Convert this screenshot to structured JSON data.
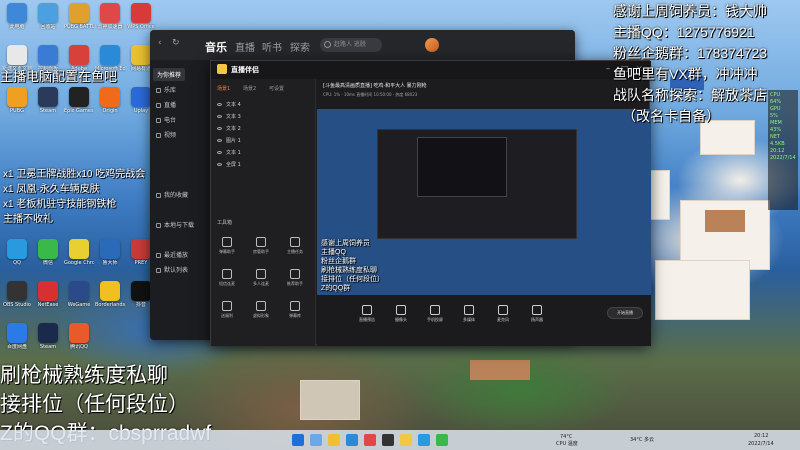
{
  "desktop": {
    "icons": [
      {
        "label": "此电脑",
        "color": "#3d88d8"
      },
      {
        "label": "回收站",
        "color": "#4aa0e0"
      },
      {
        "label": "PUBG BATTLEGR...",
        "color": "#e0a030"
      },
      {
        "label": "雷神加速器",
        "color": "#e04848"
      },
      {
        "label": "WPS Office",
        "color": "#d83a3a"
      },
      {
        "label": "新建文本文档",
        "color": "#e8e8e8"
      },
      {
        "label": "控制面板",
        "color": "#3a7bd5"
      },
      {
        "label": "Adobe",
        "color": "#d8403a"
      },
      {
        "label": "Microsoft Edge",
        "color": "#2a8ad8"
      },
      {
        "label": "网易有道",
        "color": "#e8c030"
      },
      {
        "label": "PUBG",
        "color": "#f0a020"
      },
      {
        "label": "Steam",
        "color": "#2a3a5a"
      },
      {
        "label": "Epic Games Launcher",
        "color": "#222222"
      },
      {
        "label": "Origin",
        "color": "#f06a1a"
      },
      {
        "label": "Uplay",
        "color": "#2a6ad8"
      },
      {
        "label": "QQ",
        "color": "#2a9ae0"
      },
      {
        "label": "微信",
        "color": "#3ab84a"
      },
      {
        "label": "Google Chrome",
        "color": "#e8d030"
      },
      {
        "label": "鲁大师",
        "color": "#2a6ab8"
      },
      {
        "label": "PREY",
        "color": "#c83a3a"
      },
      {
        "label": "OBS Studio",
        "color": "#333333"
      },
      {
        "label": "NetEase",
        "color": "#d83030"
      },
      {
        "label": "WeGame",
        "color": "#2a4a8a"
      },
      {
        "label": "Borderlands 3",
        "color": "#f0c020"
      },
      {
        "label": "抖音",
        "color": "#111111"
      },
      {
        "label": "百度网盘",
        "color": "#2a7ae8"
      },
      {
        "label": "Steam",
        "color": "#1a2a4a"
      },
      {
        "label": "腾讯QQ",
        "color": "#e85a2a"
      }
    ]
  },
  "overlay": {
    "right_lines": [
      "感谢上周饲养员：钱大帅",
      "主播QQ：1275776921",
      "粉丝企鹅群：178374723",
      "鱼吧里有VX群，冲冲冲",
      "战队名称探索：解放茶店",
      "（改名卡自备）"
    ],
    "left_top": "主播电脑配置在鱼吧",
    "left_mid": [
      "x1 卫冕王牌战胜x10 吃鸡完战会",
      "x1 凤凰·永久车辆皮肤",
      "x1 老板机驻守技能钢铁枪",
      "主播不收礼"
    ],
    "left_bottom": [
      "刷枪械熟练度私聊",
      "接排位（任何段位）",
      "Z的QQ群：cbsprradwf"
    ],
    "preview_lines": [
      "感谢上周饲养员",
      "主播QQ",
      "粉丝企鹅群",
      "刷枪械熟练度私聊",
      "接排位（任何段位）",
      "Z的QQ群"
    ]
  },
  "hw_monitor": {
    "rows": [
      "CPU",
      "64%",
      "GPU",
      "5%",
      "MEM",
      "43%",
      "NET",
      "4.5KB",
      "20:12",
      "2022/7/14"
    ]
  },
  "music_app": {
    "tabs": [
      "音乐",
      "直播",
      "听书",
      "探索"
    ],
    "search_placeholder": "赶路人 逃脱",
    "sidebar": [
      "为你推荐",
      "乐库",
      "直播",
      "电台",
      "视频",
      "我的收藏",
      "本地与下载",
      "最近播放",
      "默认列表"
    ]
  },
  "stream_app": {
    "brand": "直播伴侣",
    "side_tabs": [
      "场景1",
      "场景2",
      "可设置"
    ],
    "scenes": [
      "文本 4",
      "文本 3",
      "文本 2",
      "图片 1",
      "文本 1",
      "全屏 1"
    ],
    "tools_title": "工具箱",
    "tools": [
      "弹幕助手",
      "房管助手",
      "主播任务",
      "短信连麦",
      "多人连麦",
      "推荐助手",
      "送福利",
      "虚拟形象",
      "弹幕库"
    ],
    "room_title": "[斗鱼最高清画质直播] 吃鸡·和平大人 暴力刚枪",
    "room_meta": "CPU: 1% · 10ms 直播时间 10:50:00 · 热度 68023",
    "bottom_tools": [
      "直播预告",
      "摄像头",
      "手机投屏",
      "多媒体",
      "麦克风",
      "扬声器"
    ],
    "bottom_right": [
      "开始直播"
    ]
  },
  "taskbar": {
    "weather": "74°C",
    "weather_sub": "CPU 温度",
    "status": "34°C 多云",
    "time": "20:12",
    "date": "2022/7/14"
  }
}
